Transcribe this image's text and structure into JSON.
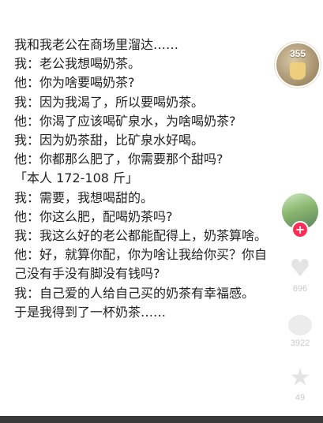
{
  "story": {
    "lines": [
      "我和我老公在商场里溜达……",
      "我：老公我想喝奶茶。",
      "他：你为啥要喝奶茶?",
      "我：因为我渴了，所以要喝奶茶。",
      "他：你渴了应该喝矿泉水，为啥喝奶茶?",
      "我：因为奶茶甜，比矿泉水好喝。",
      "他：你都那么肥了，你需要那个甜吗?",
      "「本人 172-108 斤」",
      "我：需要，我想喝甜的。",
      "他：你这么肥，配喝奶茶吗?",
      "我：我这么好的老公都能配得上，奶茶算啥。",
      "他：好，就算你配，你为啥让我给你买？你自",
      "己没有手没有脚没有钱吗?",
      "我：自己爱的人给自己买的奶茶有幸福感。",
      "于是我得到了一杯奶茶……"
    ]
  },
  "sidebar": {
    "badge_count": "355",
    "follow_symbol": "+",
    "like_count": "696",
    "comment_count": "3922",
    "favorite_count": "49"
  },
  "icons": {
    "like": "heart-icon",
    "comment": "comment-icon",
    "favorite": "star-icon"
  },
  "colors": {
    "text": "#222222",
    "follow_accent": "#fe2c55"
  }
}
